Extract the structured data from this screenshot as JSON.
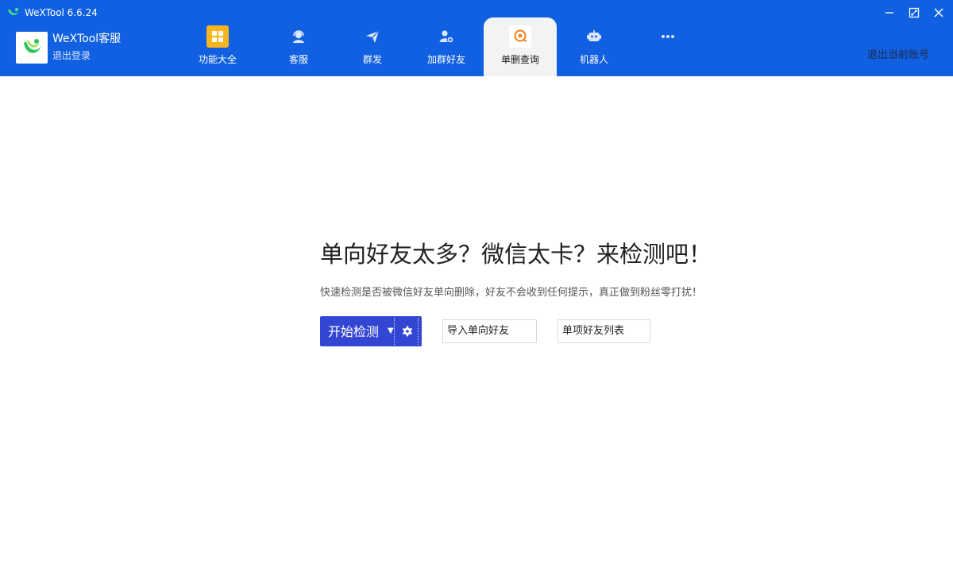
{
  "titlebar": {
    "app_title": "WeXTool 6.6.24"
  },
  "account": {
    "name": "WeXTool客服",
    "logout": "退出登录"
  },
  "nav": [
    {
      "label": "功能大全",
      "icon": "grid-icon"
    },
    {
      "label": "客服",
      "icon": "headset-icon"
    },
    {
      "label": "群发",
      "icon": "send-icon"
    },
    {
      "label": "加群好友",
      "icon": "add-user-icon"
    },
    {
      "label": "单删查询",
      "icon": "search-chat-icon",
      "active": true
    },
    {
      "label": "机器人",
      "icon": "robot-icon"
    },
    {
      "label": "",
      "icon": "more-icon"
    }
  ],
  "header": {
    "logout_account": "退出当前账号"
  },
  "main": {
    "heading": "单向好友太多？微信太卡？来检测吧！",
    "description": "快速检测是否被微信好友单向删除，好友不会收到任何提示，真正做到粉丝零打扰！",
    "start_button": "开始检测",
    "import_button": "导入单向好友",
    "list_button": "单项好友列表"
  },
  "colors": {
    "header_bg": "#1160e2",
    "primary_button": "#3346d3",
    "active_tab_bg": "#f2f3f5",
    "grid_icon_bg": "#f7b51e",
    "search_icon": "#f08a24"
  }
}
